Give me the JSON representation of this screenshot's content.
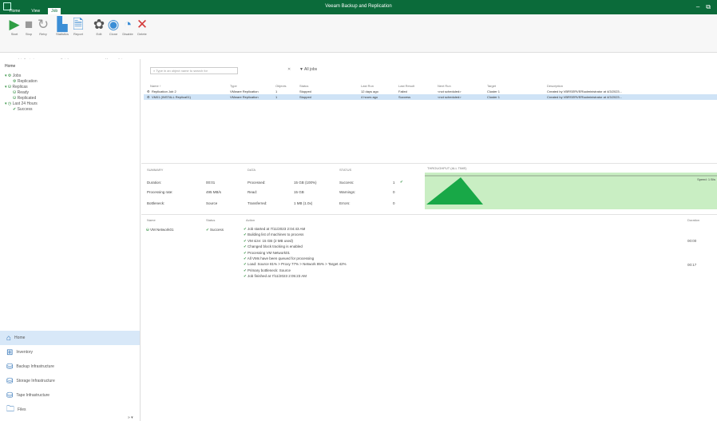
{
  "window": {
    "title": "Veeam Backup and Replication",
    "menu": [
      "Home",
      "View",
      "Job"
    ],
    "controls": [
      "–",
      "⧉"
    ]
  },
  "ribbon": {
    "tools": [
      {
        "name": "start",
        "label": "Start",
        "icon": "▶",
        "color": "#2f9e44"
      },
      {
        "name": "stop",
        "label": "Stop",
        "icon": "■",
        "color": "#999999"
      },
      {
        "name": "retry",
        "label": "Retry",
        "icon": "↻",
        "color": "#999999"
      },
      {
        "name": "statistics",
        "label": "Statistics",
        "icon": "▙",
        "color": "#3b8ed6"
      },
      {
        "name": "report",
        "label": "Report",
        "icon": "🗎",
        "color": "#3b8ed6"
      },
      {
        "name": "edit",
        "label": "Edit",
        "icon": "✿",
        "color": "#555555"
      },
      {
        "name": "clone",
        "label": "Clone",
        "icon": "◉",
        "color": "#3b8ed6"
      },
      {
        "name": "disable",
        "label": "Disable",
        "icon": "◔",
        "color": "#3b8ed6"
      },
      {
        "name": "delete",
        "label": "Delete",
        "icon": "✕",
        "color": "#d43b3b"
      }
    ],
    "groups": [
      "Job Control",
      "Details",
      "Manage Job"
    ]
  },
  "left_pane": {
    "header": "Home",
    "tree": [
      "Jobs",
      "Replication",
      "Replicas",
      "Ready",
      "Replicated",
      "Last 24 Hours",
      "Success"
    ],
    "nav": [
      {
        "label": "Home",
        "active": true,
        "icon": "⌂"
      },
      {
        "label": "Inventory",
        "active": false,
        "icon": "⊞"
      },
      {
        "label": "Backup Infrastructure",
        "active": false,
        "icon": "⛁"
      },
      {
        "label": "Storage Infrastructure",
        "active": false,
        "icon": "⛁"
      },
      {
        "label": "Tape Infrastructure",
        "active": false,
        "icon": "⛁"
      },
      {
        "label": "Files",
        "active": false,
        "icon": "🗀"
      }
    ],
    "collapse": "» ▾"
  },
  "search": {
    "placeholder": "Type in an object name to search for",
    "clear": "✕",
    "filter": "▼ All jobs"
  },
  "jobs": {
    "columns": [
      "Name ↑",
      "Type",
      "Objects",
      "Status",
      "Last Run",
      "Last Result",
      "Next Run",
      "Target",
      "Description"
    ],
    "rows": [
      [
        "Replication Job 2",
        "VMware Replication",
        "1",
        "Stopped",
        "12 days ago",
        "Failed",
        "<not scheduled>",
        "Cluster 1",
        "Created by VBRSERVER\\administrator at 4/3/2023..."
      ],
      [
        "VM01 (INSTALL Replica01)",
        "VMware Replication",
        "1",
        "Stopped",
        "4 hours ago",
        "Success",
        "<not scheduled>",
        "Cluster 1",
        "Created by VBRSERVER\\administrator at 4/3/2023..."
      ]
    ]
  },
  "summary": {
    "headers": [
      "SUMMARY",
      "DATA",
      "STATUS",
      "THROUGHPUT (ALL TIME)"
    ],
    "col1": [
      [
        "Duration:",
        "00:01"
      ],
      [
        "Processing rate:",
        "495 MB/s"
      ],
      [
        "Bottleneck:",
        "Source"
      ]
    ],
    "col2": [
      [
        "Processed:",
        "15 GB (100%)"
      ],
      [
        "Read:",
        "15 GB"
      ],
      [
        "Transferred:",
        "1 MB (1.0x)"
      ]
    ],
    "col3": [
      [
        "Success:",
        "1"
      ],
      [
        "Warnings:",
        "0"
      ],
      [
        "Errors:",
        "0"
      ]
    ],
    "speed": "Speed: 1 B/s"
  },
  "details": {
    "headers": [
      "Name",
      "Status",
      "Action",
      "Duration"
    ],
    "vm": {
      "name": "VM Network01",
      "status": "Success"
    },
    "log": [
      "Job started at 7/11/2023 2:04:43 AM",
      "Building list of machines to process",
      "VM size: 15 GB (2 MB used)",
      "Changed block tracking is enabled",
      "Processing VM Network01",
      "All VMs have been queued for processing",
      "Load: Source 81% > Proxy 77% > Network 85% > Target 42%",
      "Primary bottleneck: Source",
      "Job finished at 7/11/2023 2:05:23 AM"
    ],
    "durations": [
      "00:00",
      "00:17"
    ]
  },
  "colors": {
    "brand": "#0b6b3a",
    "selected_row": "#cfe3f6",
    "chart_fill": "#c9eec3",
    "chart_peak": "#18a847"
  }
}
